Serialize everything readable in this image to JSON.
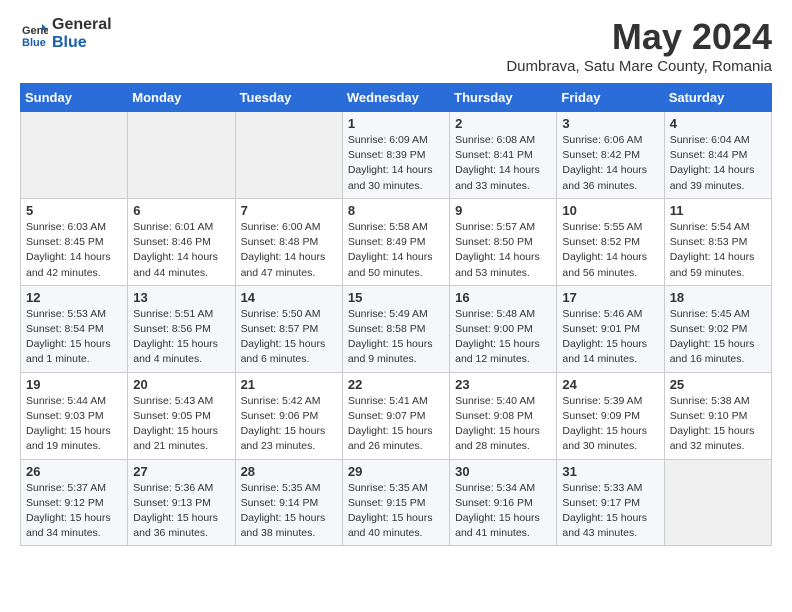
{
  "header": {
    "logo_general": "General",
    "logo_blue": "Blue",
    "title": "May 2024",
    "subtitle": "Dumbrava, Satu Mare County, Romania"
  },
  "days_of_week": [
    "Sunday",
    "Monday",
    "Tuesday",
    "Wednesday",
    "Thursday",
    "Friday",
    "Saturday"
  ],
  "weeks": [
    [
      {
        "day": "",
        "info": ""
      },
      {
        "day": "",
        "info": ""
      },
      {
        "day": "",
        "info": ""
      },
      {
        "day": "1",
        "info": "Sunrise: 6:09 AM\nSunset: 8:39 PM\nDaylight: 14 hours\nand 30 minutes."
      },
      {
        "day": "2",
        "info": "Sunrise: 6:08 AM\nSunset: 8:41 PM\nDaylight: 14 hours\nand 33 minutes."
      },
      {
        "day": "3",
        "info": "Sunrise: 6:06 AM\nSunset: 8:42 PM\nDaylight: 14 hours\nand 36 minutes."
      },
      {
        "day": "4",
        "info": "Sunrise: 6:04 AM\nSunset: 8:44 PM\nDaylight: 14 hours\nand 39 minutes."
      }
    ],
    [
      {
        "day": "5",
        "info": "Sunrise: 6:03 AM\nSunset: 8:45 PM\nDaylight: 14 hours\nand 42 minutes."
      },
      {
        "day": "6",
        "info": "Sunrise: 6:01 AM\nSunset: 8:46 PM\nDaylight: 14 hours\nand 44 minutes."
      },
      {
        "day": "7",
        "info": "Sunrise: 6:00 AM\nSunset: 8:48 PM\nDaylight: 14 hours\nand 47 minutes."
      },
      {
        "day": "8",
        "info": "Sunrise: 5:58 AM\nSunset: 8:49 PM\nDaylight: 14 hours\nand 50 minutes."
      },
      {
        "day": "9",
        "info": "Sunrise: 5:57 AM\nSunset: 8:50 PM\nDaylight: 14 hours\nand 53 minutes."
      },
      {
        "day": "10",
        "info": "Sunrise: 5:55 AM\nSunset: 8:52 PM\nDaylight: 14 hours\nand 56 minutes."
      },
      {
        "day": "11",
        "info": "Sunrise: 5:54 AM\nSunset: 8:53 PM\nDaylight: 14 hours\nand 59 minutes."
      }
    ],
    [
      {
        "day": "12",
        "info": "Sunrise: 5:53 AM\nSunset: 8:54 PM\nDaylight: 15 hours\nand 1 minute."
      },
      {
        "day": "13",
        "info": "Sunrise: 5:51 AM\nSunset: 8:56 PM\nDaylight: 15 hours\nand 4 minutes."
      },
      {
        "day": "14",
        "info": "Sunrise: 5:50 AM\nSunset: 8:57 PM\nDaylight: 15 hours\nand 6 minutes."
      },
      {
        "day": "15",
        "info": "Sunrise: 5:49 AM\nSunset: 8:58 PM\nDaylight: 15 hours\nand 9 minutes."
      },
      {
        "day": "16",
        "info": "Sunrise: 5:48 AM\nSunset: 9:00 PM\nDaylight: 15 hours\nand 12 minutes."
      },
      {
        "day": "17",
        "info": "Sunrise: 5:46 AM\nSunset: 9:01 PM\nDaylight: 15 hours\nand 14 minutes."
      },
      {
        "day": "18",
        "info": "Sunrise: 5:45 AM\nSunset: 9:02 PM\nDaylight: 15 hours\nand 16 minutes."
      }
    ],
    [
      {
        "day": "19",
        "info": "Sunrise: 5:44 AM\nSunset: 9:03 PM\nDaylight: 15 hours\nand 19 minutes."
      },
      {
        "day": "20",
        "info": "Sunrise: 5:43 AM\nSunset: 9:05 PM\nDaylight: 15 hours\nand 21 minutes."
      },
      {
        "day": "21",
        "info": "Sunrise: 5:42 AM\nSunset: 9:06 PM\nDaylight: 15 hours\nand 23 minutes."
      },
      {
        "day": "22",
        "info": "Sunrise: 5:41 AM\nSunset: 9:07 PM\nDaylight: 15 hours\nand 26 minutes."
      },
      {
        "day": "23",
        "info": "Sunrise: 5:40 AM\nSunset: 9:08 PM\nDaylight: 15 hours\nand 28 minutes."
      },
      {
        "day": "24",
        "info": "Sunrise: 5:39 AM\nSunset: 9:09 PM\nDaylight: 15 hours\nand 30 minutes."
      },
      {
        "day": "25",
        "info": "Sunrise: 5:38 AM\nSunset: 9:10 PM\nDaylight: 15 hours\nand 32 minutes."
      }
    ],
    [
      {
        "day": "26",
        "info": "Sunrise: 5:37 AM\nSunset: 9:12 PM\nDaylight: 15 hours\nand 34 minutes."
      },
      {
        "day": "27",
        "info": "Sunrise: 5:36 AM\nSunset: 9:13 PM\nDaylight: 15 hours\nand 36 minutes."
      },
      {
        "day": "28",
        "info": "Sunrise: 5:35 AM\nSunset: 9:14 PM\nDaylight: 15 hours\nand 38 minutes."
      },
      {
        "day": "29",
        "info": "Sunrise: 5:35 AM\nSunset: 9:15 PM\nDaylight: 15 hours\nand 40 minutes."
      },
      {
        "day": "30",
        "info": "Sunrise: 5:34 AM\nSunset: 9:16 PM\nDaylight: 15 hours\nand 41 minutes."
      },
      {
        "day": "31",
        "info": "Sunrise: 5:33 AM\nSunset: 9:17 PM\nDaylight: 15 hours\nand 43 minutes."
      },
      {
        "day": "",
        "info": ""
      }
    ]
  ]
}
